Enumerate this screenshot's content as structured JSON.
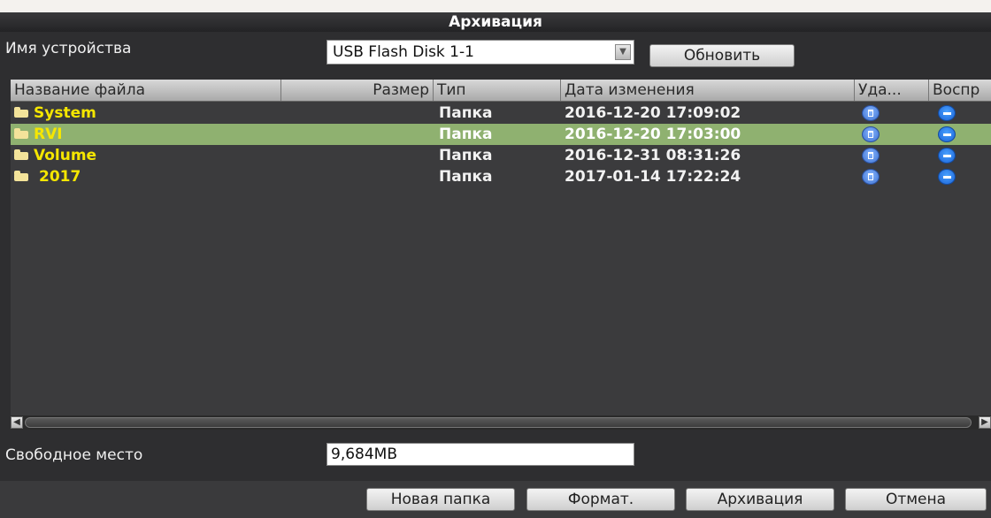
{
  "dialog": {
    "title": "Архивация"
  },
  "device": {
    "label": "Имя устройства",
    "selected": "USB Flash Disk 1-1",
    "refresh_label": "Обновить"
  },
  "table": {
    "columns": [
      "Название файла",
      "Размер",
      "Тип",
      "Дата изменения",
      "Уда...",
      "Воспр"
    ],
    "rows": [
      {
        "name": "System",
        "size": "",
        "type": "Папка",
        "modified": "2016-12-20 17:09:02"
      },
      {
        "name": "RVI",
        "size": "",
        "type": "Папка",
        "modified": "2016-12-20 17:03:00",
        "selected": true
      },
      {
        "name": "Volume",
        "size": "",
        "type": "Папка",
        "modified": "2016-12-31 08:31:26"
      },
      {
        "name": "2017",
        "size": "",
        "type": "Папка",
        "modified": "2017-01-14 17:22:24"
      }
    ]
  },
  "free_space": {
    "label": "Свободное место",
    "value": "9,684MB"
  },
  "footer": {
    "new_folder_label": "Новая папка",
    "format_label": "Формат.",
    "backup_label": "Архивация",
    "cancel_label": "Отмена"
  },
  "icons": {
    "folder": "folder-icon",
    "delete": "trash-icon",
    "play": "play-icon"
  },
  "colors": {
    "selected_row": "#8fb170",
    "folder_name": "#f5e600",
    "background": "#2e2e30"
  }
}
